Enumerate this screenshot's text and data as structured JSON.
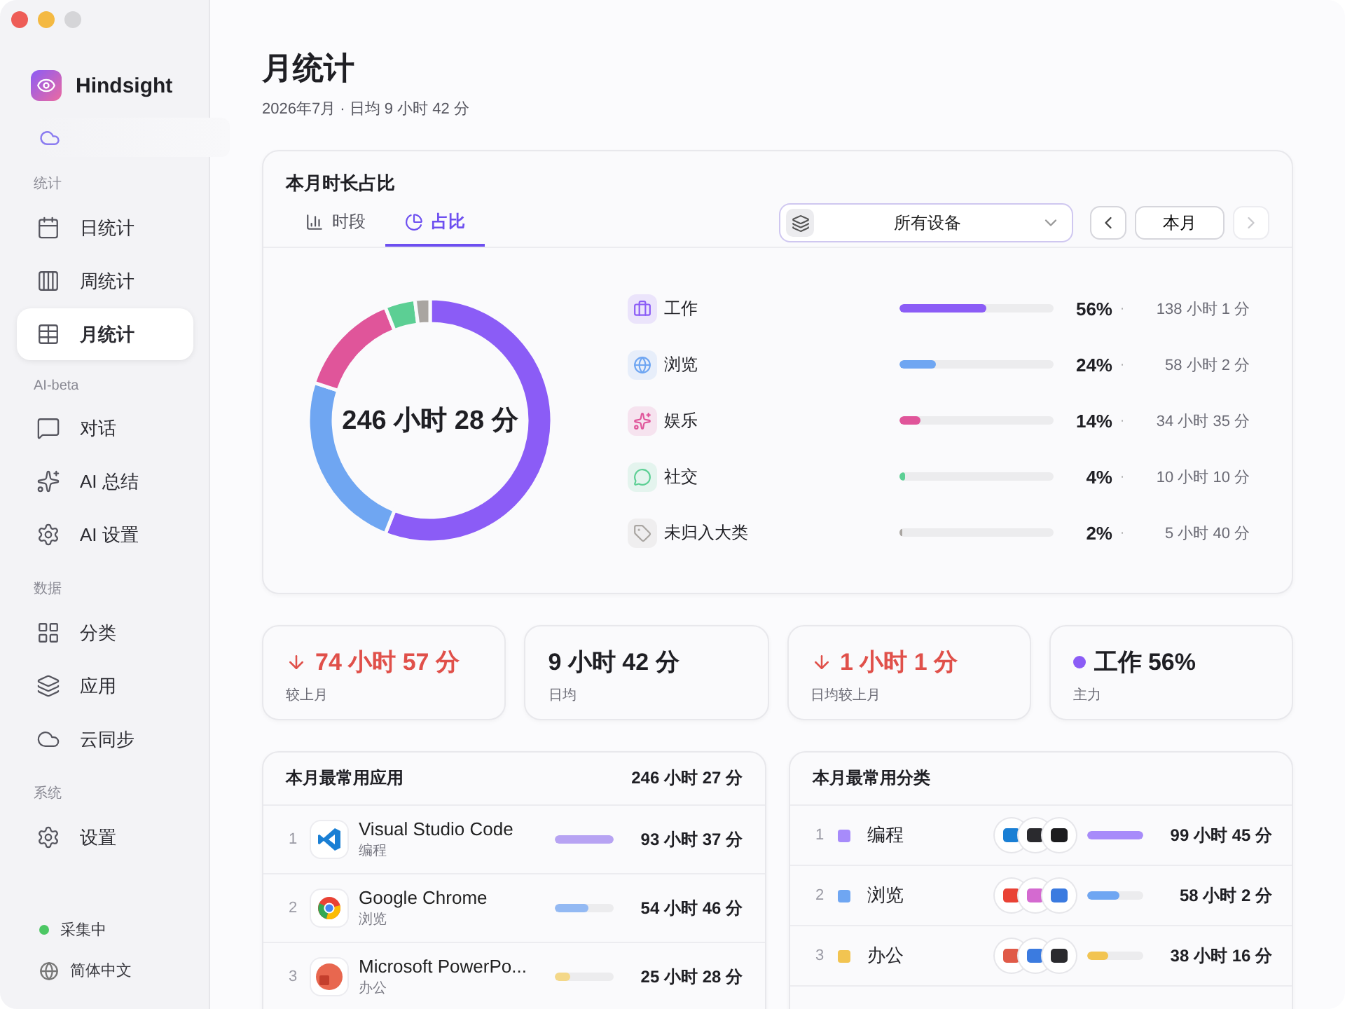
{
  "app": {
    "name": "Hindsight"
  },
  "nav": [
    {
      "title": "统计",
      "items": [
        {
          "label": "日统计",
          "selected": false
        },
        {
          "label": "周统计",
          "selected": false
        },
        {
          "label": "月统计",
          "selected": true
        }
      ]
    },
    {
      "title": "AI-beta",
      "items": [
        {
          "label": "对话",
          "selected": false
        },
        {
          "label": "AI 总结",
          "selected": false
        },
        {
          "label": "AI 设置",
          "selected": false
        }
      ]
    },
    {
      "title": "数据",
      "items": [
        {
          "label": "分类",
          "selected": false
        },
        {
          "label": "应用",
          "selected": false
        },
        {
          "label": "云同步",
          "selected": false
        }
      ]
    },
    {
      "title": "系统",
      "items": [
        {
          "label": "设置",
          "selected": false
        }
      ]
    }
  ],
  "status": {
    "label": "采集中",
    "color": "#4cc764"
  },
  "language": "简体中文",
  "page": {
    "title": "月统计",
    "subtitle": "2026年7月 · 日均 9 小时 42 分"
  },
  "share_card": {
    "title": "本月时长占比",
    "tabs": [
      {
        "label": "时段",
        "selected": false
      },
      {
        "label": "占比",
        "selected": true
      }
    ],
    "device_select": {
      "value": "所有设备"
    },
    "period_button": "本月",
    "prev_disabled": false,
    "next_disabled": true,
    "total": "246 小时 28 分",
    "chart_data": {
      "type": "donut",
      "categories": [
        "工作",
        "浏览",
        "娱乐",
        "社交",
        "未归入大类"
      ],
      "values": [
        56,
        24,
        14,
        4,
        2
      ]
    },
    "categories": [
      {
        "color": "#8b5cf6",
        "level": 0.56,
        "percent": "56%",
        "separator": "·",
        "time": "138 小时 1 分"
      },
      {
        "color": "#6fa6f2",
        "level": 0.24,
        "percent": "24%",
        "separator": "·",
        "time": "58 小时 2 分"
      },
      {
        "color": "#e0559a",
        "level": 0.14,
        "percent": "14%",
        "separator": "·",
        "time": "34 小时 35 分"
      },
      {
        "color": "#5ccf94",
        "level": 0.04,
        "percent": "4%",
        "separator": "·",
        "time": "10 小时 10 分"
      },
      {
        "color": "#a9a5a1",
        "level": 0.02,
        "percent": "2%",
        "separator": "·",
        "time": "5 小时 40 分"
      }
    ]
  },
  "stats": [
    {
      "kind": "down",
      "value": "74 小时 57 分",
      "label": "较上月"
    },
    {
      "kind": "plain",
      "value": "9 小时 42 分",
      "label": "日均"
    },
    {
      "kind": "down",
      "value": "1 小时 1 分",
      "label": "日均较上月"
    },
    {
      "kind": "dot",
      "color": "#8b5cf6",
      "value": "工作 56%",
      "label": "主力"
    }
  ],
  "top_apps": {
    "title": "本月最常用应用",
    "total": "246 小时 27 分",
    "rows": [
      {
        "rank": "1",
        "name": "Visual Studio Code",
        "category": "编程",
        "color": "#b7a3f3",
        "level": 1,
        "time": "93 小时 37 分"
      },
      {
        "rank": "2",
        "name": "Google Chrome",
        "category": "浏览",
        "color": "#93b9f3",
        "level": 0.58,
        "time": "54 小时 46 分"
      },
      {
        "rank": "3",
        "name": "Microsoft PowerPo...",
        "category": "办公",
        "color": "#f4d889",
        "level": 0.27,
        "time": "25 小时 28 分"
      }
    ]
  },
  "top_categories": {
    "title": "本月最常用分类",
    "rows": [
      {
        "rank": "1",
        "name": "编程",
        "color": "#a78bfa",
        "level": 1,
        "time": "99 小时 45 分"
      },
      {
        "rank": "2",
        "name": "浏览",
        "color": "#6fa6f2",
        "level": 0.58,
        "time": "58 小时 2 分"
      },
      {
        "rank": "3",
        "name": "办公",
        "color": "#f2c451",
        "level": 0.38,
        "time": "38 小时 16 分"
      }
    ]
  }
}
